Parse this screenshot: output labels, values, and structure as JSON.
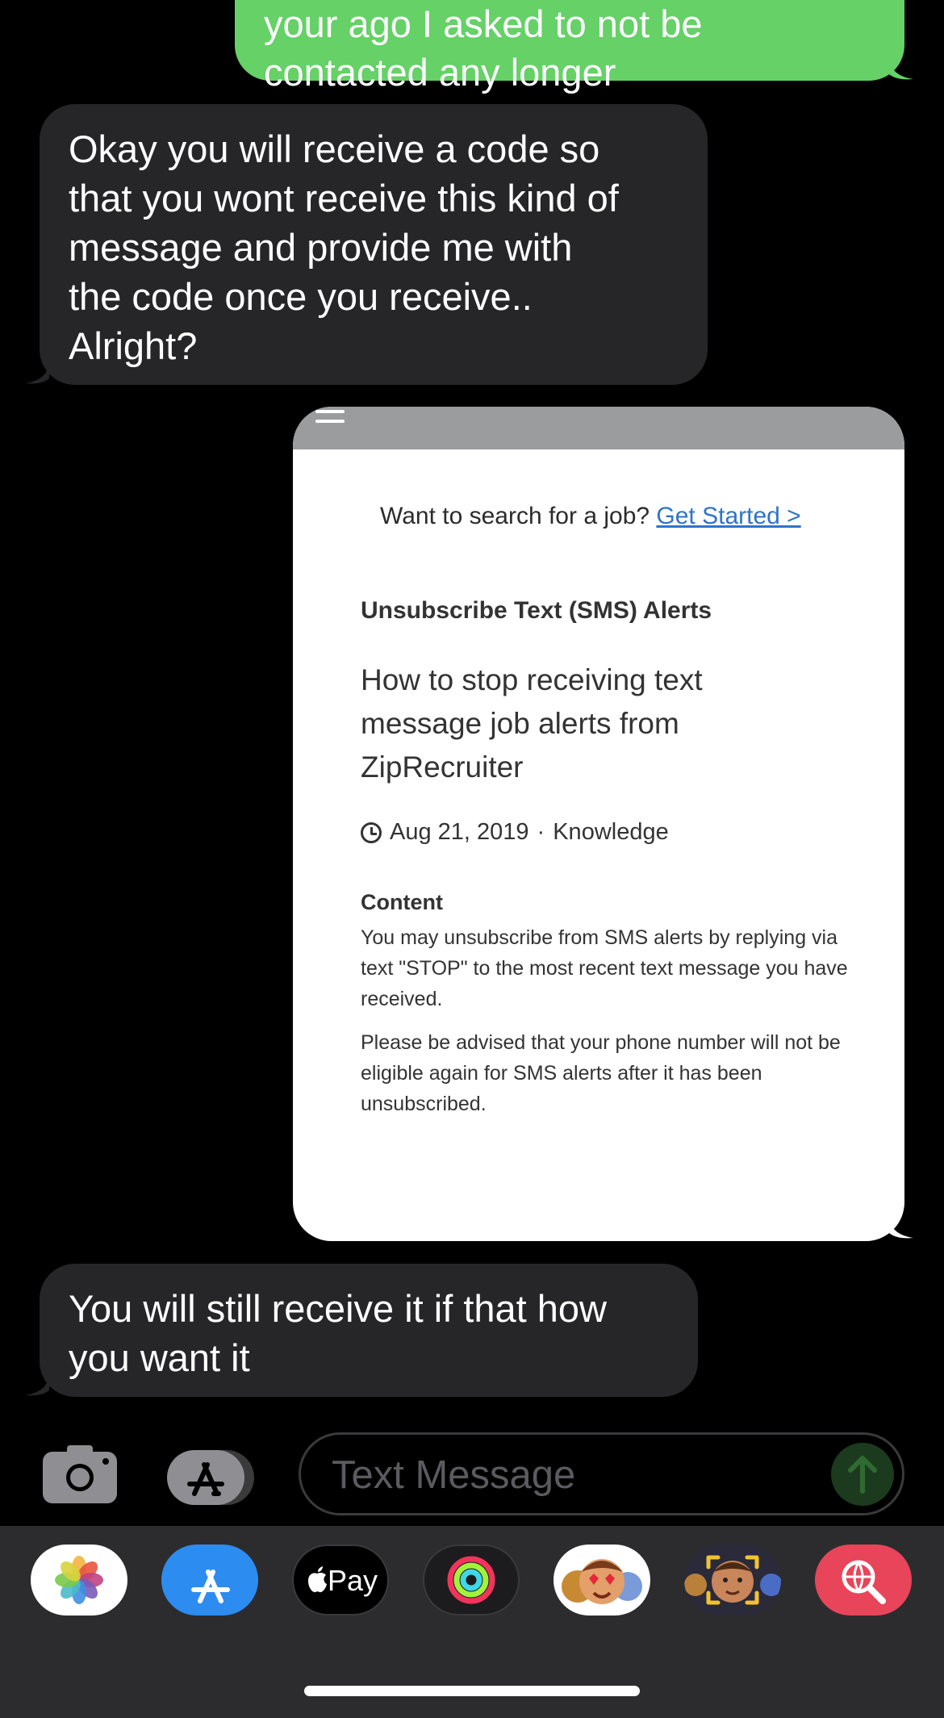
{
  "messages": [
    {
      "direction": "outgoing",
      "text": "your ago I asked to not be\ncontacted any longer"
    },
    {
      "direction": "incoming",
      "text": "Okay you will receive a code so\nthat you wont receive this kind of\nmessage and provide me with\nthe code once you receive..\nAlright?"
    },
    {
      "direction": "outgoing",
      "type": "screenshot"
    },
    {
      "direction": "incoming",
      "text": "You will still receive it if that how\nyou want it"
    }
  ],
  "shared_screenshot": {
    "job_prompt": "Want to search for a job?",
    "job_link": "Get Started >",
    "section_title": "Unsubscribe Text (SMS) Alerts",
    "article_title": "How to stop receiving text message job alerts from ZipRecruiter",
    "date": "Aug 21, 2019",
    "separator": "·",
    "category": "Knowledge",
    "content_label": "Content",
    "paragraph_1": "You may unsubscribe from SMS alerts by replying via text \"STOP\" to the most recent text message you have received.",
    "paragraph_2": "Please be advised that your phone number will not be eligible again for SMS alerts after it has been unsubscribed."
  },
  "input_bar": {
    "placeholder": "Text Message"
  },
  "app_drawer": {
    "apps": [
      "Photos",
      "App Store",
      "Apple Pay",
      "Activity",
      "Memoji Stickers",
      "Memoji",
      "Search Images"
    ],
    "apple_pay_label": "Pay"
  },
  "colors": {
    "outgoing_bubble": "#65d167",
    "incoming_bubble": "#262628",
    "background": "#000000",
    "drawer": "#2c2c2e",
    "link": "#2f74c7"
  }
}
